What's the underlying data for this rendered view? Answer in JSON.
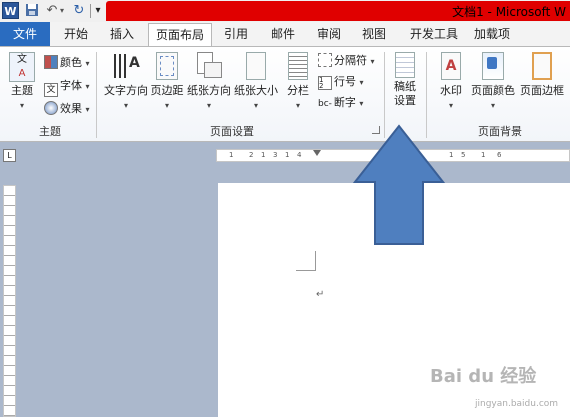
{
  "window": {
    "title": "文档1 - Microsoft W"
  },
  "qat": {
    "word_icon": "W",
    "save_icon": "save-icon",
    "undo_icon": "↶",
    "redo_icon": "↻",
    "more_icon": "▾"
  },
  "tabs": [
    {
      "label": "文件"
    },
    {
      "label": "开始"
    },
    {
      "label": "插入"
    },
    {
      "label": "页面布局"
    },
    {
      "label": "引用"
    },
    {
      "label": "邮件"
    },
    {
      "label": "审阅"
    },
    {
      "label": "视图"
    },
    {
      "label": "开发工具"
    },
    {
      "label": "加载项"
    }
  ],
  "ribbon": {
    "themes": {
      "group_label": "主题",
      "theme_button": "主题",
      "colors": "颜色",
      "fonts": "字体",
      "effects": "效果"
    },
    "page_setup": {
      "group_label": "页面设置",
      "text_direction": "文字方向",
      "margins": "页边距",
      "orientation": "纸张方向",
      "size": "纸张大小",
      "columns": "分栏",
      "breaks": "分隔符",
      "line_numbers": "行号",
      "hyphenation": "断字",
      "stationery_line1": "稿纸",
      "stationery_line2": "设置",
      "text_direction_icon_text": "A"
    },
    "page_background": {
      "group_label": "页面背景",
      "watermark": "水印",
      "page_color": "页面颜色",
      "page_borders": "页面边框"
    }
  },
  "ruler": {
    "horizontal_ticks": [
      "1",
      "2",
      "1",
      "3",
      "1",
      "4",
      "1",
      "5",
      "1",
      "6"
    ],
    "corner": "L"
  },
  "document": {
    "paragraph_mark": "↵"
  },
  "overlay": {
    "watermark_text": "Bai du 经验",
    "watermark_url": "jingyan.baidu.com"
  },
  "colors": {
    "file_tab": "#2a6cc0",
    "title_bar": "#e00000",
    "doc_bg": "#abb8cc",
    "arrow": "#4f7fbf"
  }
}
